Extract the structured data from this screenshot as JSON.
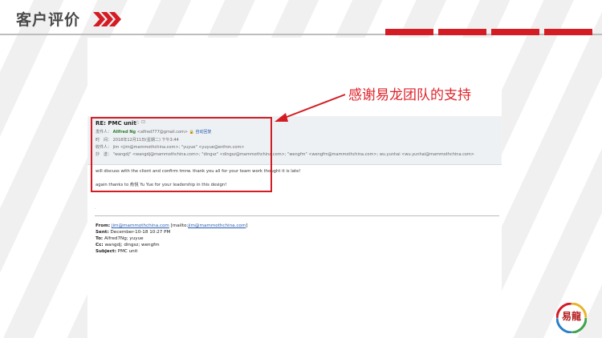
{
  "colors": {
    "accent": "#d41c24",
    "title_gray": "#4a4a4a",
    "header_bg": "#eef1f4"
  },
  "slide": {
    "title": "客户评价",
    "callout_text": "感谢易龙团队的支持"
  },
  "email": {
    "subject": "RE: PMC unit",
    "icons": {
      "star": "star-icon",
      "subject_action": "restore-icon",
      "lock": "lock-icon"
    },
    "from_label": "发件人：",
    "from_name": "Allfred Ng",
    "from_addr": "<alfred777@gmail.com>",
    "from_action": "自动回复",
    "time_label": "时　间：",
    "time_value": "2018年12月11日(星期二) 下午3:44",
    "to_label": "收件人：",
    "to_value": "jim <jim@mammothchina.com>; \"yuyue\" <yuyue@enfron.com>",
    "cc_label": "抄　送：",
    "cc_value": "\"wangdj\" <wangdj@mammothchina.com>; \"dingsz\" <dingsz@mammothchina.com>; \"wengfm\" <wengfm@mammothchina.com>; wu.yunhai <wu.yunhai@mammothchina.com>",
    "body_line1": "will discuss with the client and confirm tmrw.  thank you all for your team work thought it is late!",
    "body_line2": "again thanks to 俞悦 Yu Yue for your leadership in this design!",
    "dot": ".",
    "quoted": {
      "from_label": "From:",
      "from_link1": "jim@mammothchina.com",
      "from_mailto_pre": " [mailto:",
      "from_link2": "jim@mammothchina.com",
      "from_mailto_post": "]",
      "sent_label": "Sent:",
      "sent_value": "December-10-18 10:27 PM",
      "to_label": "To:",
      "to_value": "Alfred7Ng; yuyue",
      "cc_label": "Cc:",
      "cc_value": "wangdj; dingsz; wengfm",
      "subject_label": "Subject:",
      "subject_value": "PMC unit"
    }
  },
  "logo": {
    "text": "易龍",
    "icon": "yilong-logo-icon"
  }
}
